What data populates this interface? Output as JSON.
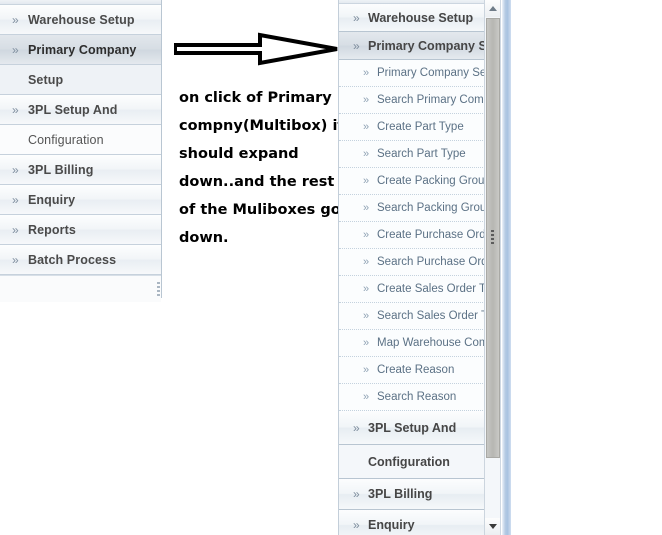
{
  "left_menu": {
    "items": [
      {
        "label": "Warehouse Setup",
        "chev": "»",
        "state": "normal"
      },
      {
        "label": "Primary Company",
        "chev": "»",
        "state": "selected"
      },
      {
        "label": "Setup",
        "chev": "",
        "state": "selected-cont"
      },
      {
        "label": "3PL Setup And",
        "chev": "»",
        "state": "normal"
      },
      {
        "label": "Configuration",
        "chev": "",
        "state": "cont"
      },
      {
        "label": "3PL Billing",
        "chev": "»",
        "state": "normal"
      },
      {
        "label": "Enquiry",
        "chev": "»",
        "state": "normal"
      },
      {
        "label": "Reports",
        "chev": "»",
        "state": "normal"
      },
      {
        "label": "Batch Process",
        "chev": "»",
        "state": "normal"
      }
    ]
  },
  "annotation": {
    "text": "on click of Primary compny(Multibox) it should expand down..and the rest of the Muliboxes go down.",
    "arrow": "right-arrow-outline"
  },
  "right_menu": {
    "items": [
      {
        "label": "Warehouse Setup",
        "chev": "»",
        "type": "header"
      },
      {
        "label": "Primary Company Set",
        "chev": "»",
        "type": "header-active"
      },
      {
        "label": "Primary Company Setup",
        "chev": "»",
        "type": "sub"
      },
      {
        "label": "Search Primary Company",
        "chev": "»",
        "type": "sub"
      },
      {
        "label": "Create Part Type",
        "chev": "»",
        "type": "sub"
      },
      {
        "label": "Search Part Type",
        "chev": "»",
        "type": "sub"
      },
      {
        "label": "Create Packing Group",
        "chev": "»",
        "type": "sub"
      },
      {
        "label": "Search Packing Group",
        "chev": "»",
        "type": "sub"
      },
      {
        "label": "Create Purchase Order Type",
        "chev": "»",
        "type": "sub"
      },
      {
        "label": "Search Purchase Order Type",
        "chev": "»",
        "type": "sub"
      },
      {
        "label": "Create Sales Order Type",
        "chev": "»",
        "type": "sub"
      },
      {
        "label": "Search Sales Order Type",
        "chev": "»",
        "type": "sub"
      },
      {
        "label": "Map Warehouse Company",
        "chev": "»",
        "type": "sub"
      },
      {
        "label": "Create Reason",
        "chev": "»",
        "type": "sub"
      },
      {
        "label": "Search Reason",
        "chev": "»",
        "type": "sub"
      },
      {
        "label": "3PL Setup And",
        "chev": "»",
        "type": "header"
      },
      {
        "label": "Configuration",
        "chev": "",
        "type": "header-cont"
      },
      {
        "label": "3PL Billing",
        "chev": "»",
        "type": "header"
      },
      {
        "label": "Enquiry",
        "chev": "»",
        "type": "header"
      }
    ]
  },
  "scrollbar": {
    "up_icon": "scroll-up-arrow",
    "down_icon": "scroll-down-arrow"
  },
  "colors": {
    "panel_bg": "#f7fafc",
    "header_text": "#464646",
    "sub_text": "#5b7185",
    "border": "#c3ced9",
    "accent_strip": "#a8c2e0"
  }
}
